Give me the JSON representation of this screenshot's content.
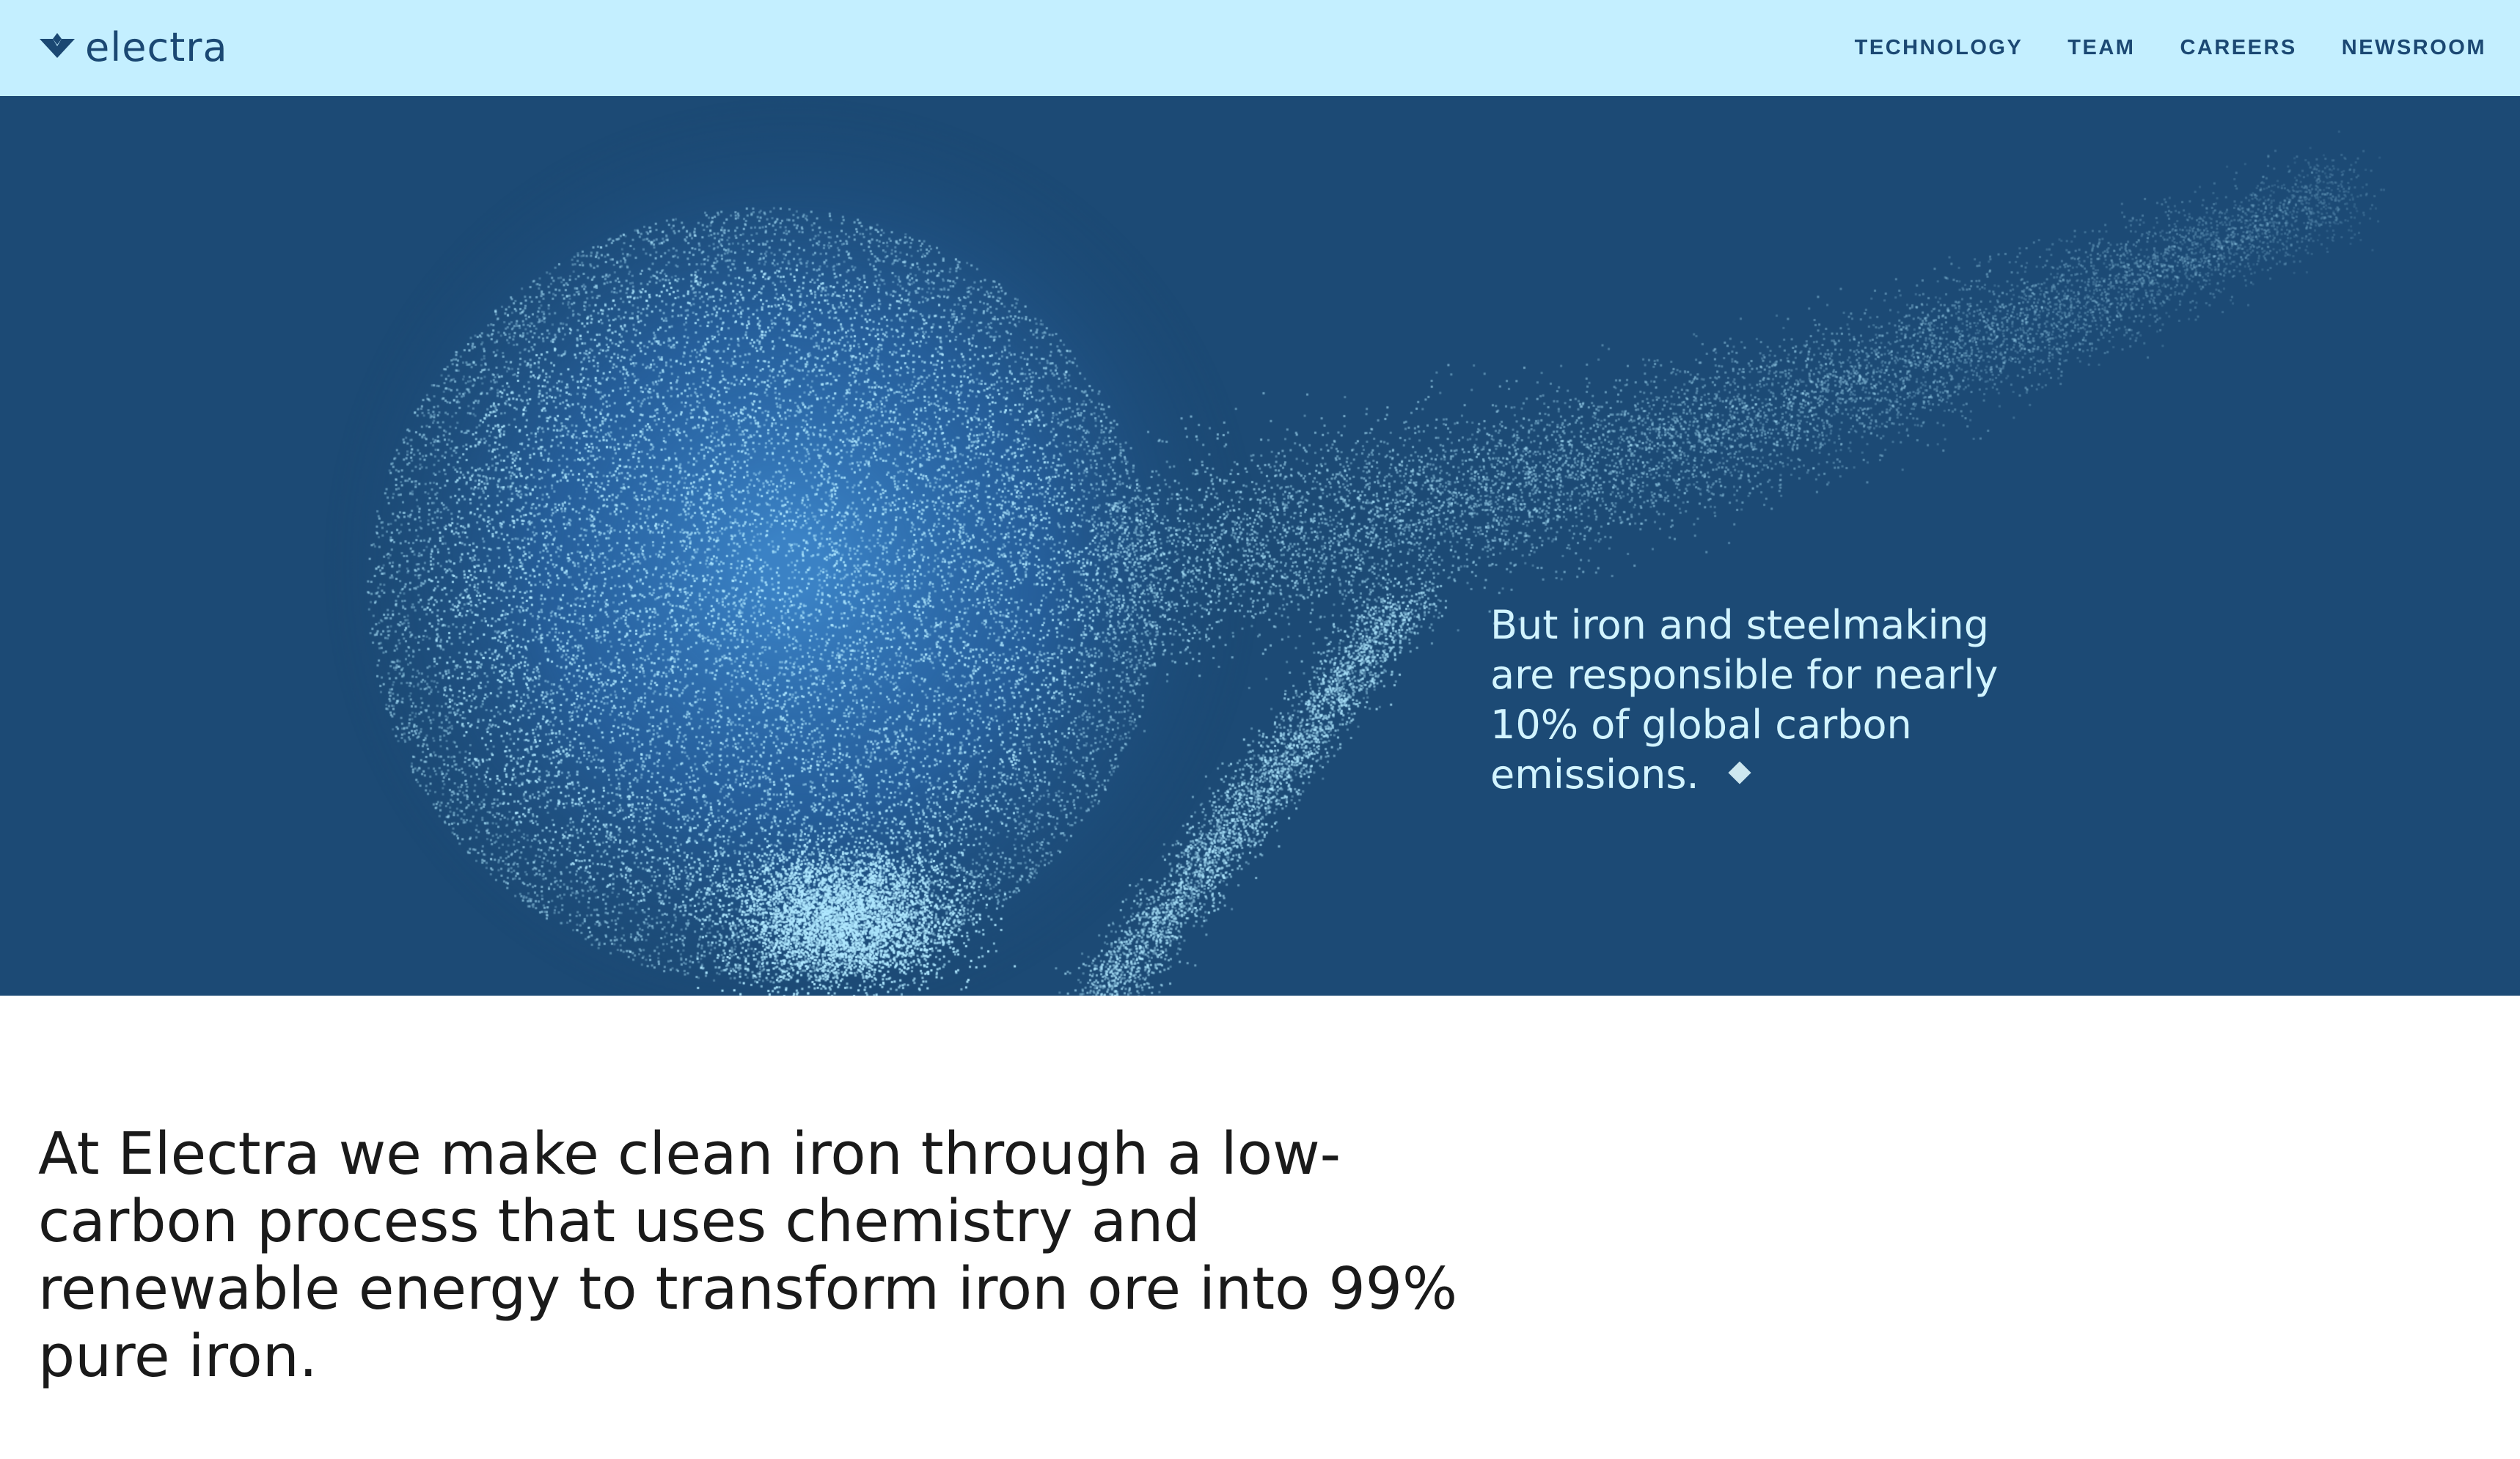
{
  "header": {
    "logo_text": "electra",
    "logo_icon": "electra-leaf-icon",
    "nav": [
      {
        "label": "TECHNOLOGY"
      },
      {
        "label": "TEAM"
      },
      {
        "label": "CAREERS"
      },
      {
        "label": "NEWSROOM"
      }
    ]
  },
  "hero": {
    "statement": "But iron and steelmaking are responsible for nearly 10% of global carbon emissions.",
    "marker_icon": "diamond-icon",
    "background_color": "#1c4a75",
    "particle_color": "#a9e6ff"
  },
  "mission": {
    "text": "At Electra we make clean iron through a low-carbon process that uses chemistry and renewable energy to transform iron ore into 99% pure iron."
  },
  "colors": {
    "header_bg": "#c4efff",
    "brand_navy": "#1b4873",
    "body_text": "#1a1a1a"
  }
}
